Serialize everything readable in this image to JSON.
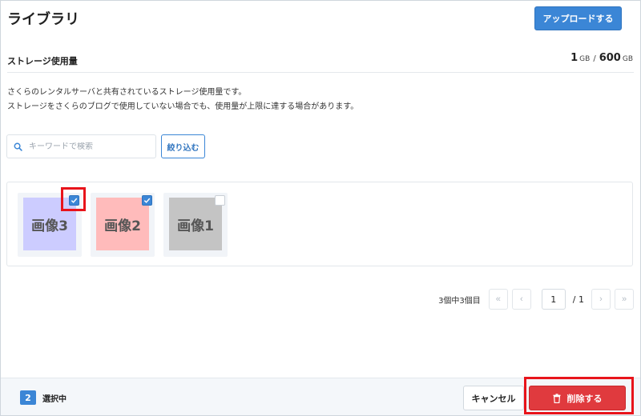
{
  "header": {
    "title": "ライブラリ",
    "upload_label": "アップロードする"
  },
  "storage": {
    "label": "ストレージ使用量",
    "used": "1",
    "used_unit": "GB",
    "separator": "/",
    "total": "600",
    "total_unit": "GB",
    "description_line1": "さくらのレンタルサーバと共有されているストレージ使用量です。",
    "description_line2": "ストレージをさくらのブログで使用していない場合でも、使用量が上限に達する場合があります。"
  },
  "search": {
    "placeholder": "キーワードで検索",
    "value": "",
    "filter_label": "絞り込む"
  },
  "gallery": {
    "items": [
      {
        "label": "画像3",
        "color": "#ccccff",
        "checked": true
      },
      {
        "label": "画像2",
        "color": "#ffbbbb",
        "checked": true
      },
      {
        "label": "画像1",
        "color": "#c4c4c4",
        "checked": false
      }
    ]
  },
  "pagination": {
    "count_text": "3個中3個目",
    "first_icon": "«",
    "prev_icon": "‹",
    "current_page": "1",
    "total_text": "/ 1",
    "next_icon": "›",
    "last_icon": "»"
  },
  "footer": {
    "selected_count": "2",
    "selected_label": "選択中",
    "cancel_label": "キャンセル",
    "delete_label": "削除する"
  },
  "colors": {
    "accent": "#3b86d6",
    "danger": "#e03a3e",
    "highlight": "#e8141b"
  }
}
